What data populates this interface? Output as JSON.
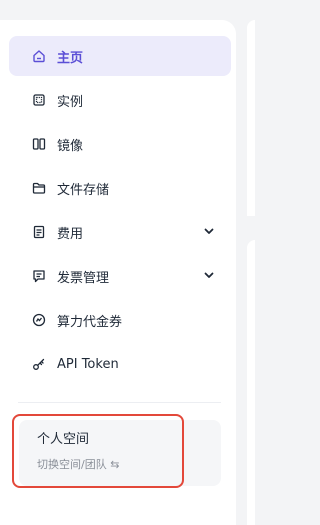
{
  "nav": {
    "items": [
      {
        "label": "主页",
        "icon": "home-icon"
      },
      {
        "label": "实例",
        "icon": "instance-icon"
      },
      {
        "label": "镜像",
        "icon": "image-icon"
      },
      {
        "label": "文件存储",
        "icon": "folder-icon"
      },
      {
        "label": "费用",
        "icon": "billing-icon"
      },
      {
        "label": "发票管理",
        "icon": "invoice-icon"
      },
      {
        "label": "算力代金券",
        "icon": "voucher-icon"
      },
      {
        "label": "API Token",
        "icon": "key-icon"
      }
    ]
  },
  "workspace": {
    "title": "个人空间",
    "subtitle": "切换空间/团队 ⇆"
  },
  "colors": {
    "accent": "#5b4fd6",
    "active_bg": "#ecebfb",
    "highlight": "#e3483a"
  }
}
